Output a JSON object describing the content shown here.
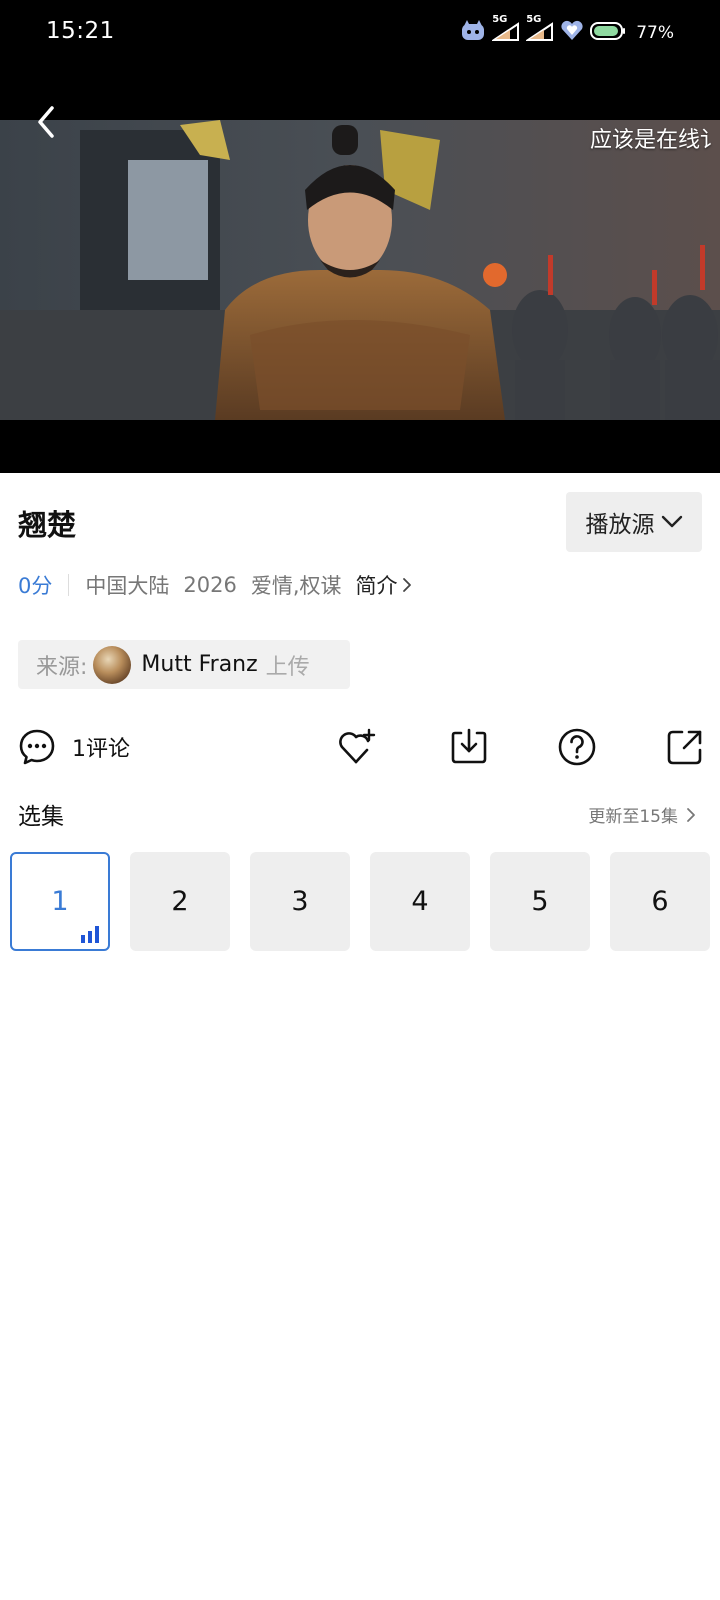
{
  "status_bar": {
    "time": "15:21",
    "battery": "77%",
    "network_labels": [
      "5G",
      "5G"
    ]
  },
  "player": {
    "danmaku": "应该是在线讠",
    "back_icon": "back-arrow-icon"
  },
  "video": {
    "title": "翘楚",
    "source_button": "播放源",
    "score": "0分",
    "region": "中国大陆",
    "year": "2026",
    "genres": "爱情,权谋",
    "intro_link": "简介"
  },
  "uploader": {
    "label": "来源:",
    "name": "Mutt Franz",
    "suffix": "上传"
  },
  "actions": {
    "comment_count": "1评论",
    "icons": [
      "comment-icon",
      "favorite-add-icon",
      "download-icon",
      "help-icon",
      "share-icon"
    ]
  },
  "episodes": {
    "label": "选集",
    "update_text": "更新至15集",
    "items": [
      "1",
      "2",
      "3",
      "4",
      "5",
      "6"
    ],
    "active_index": 0
  },
  "colors": {
    "accent": "#3a7bd5",
    "chip_bg": "#eeeeee"
  }
}
